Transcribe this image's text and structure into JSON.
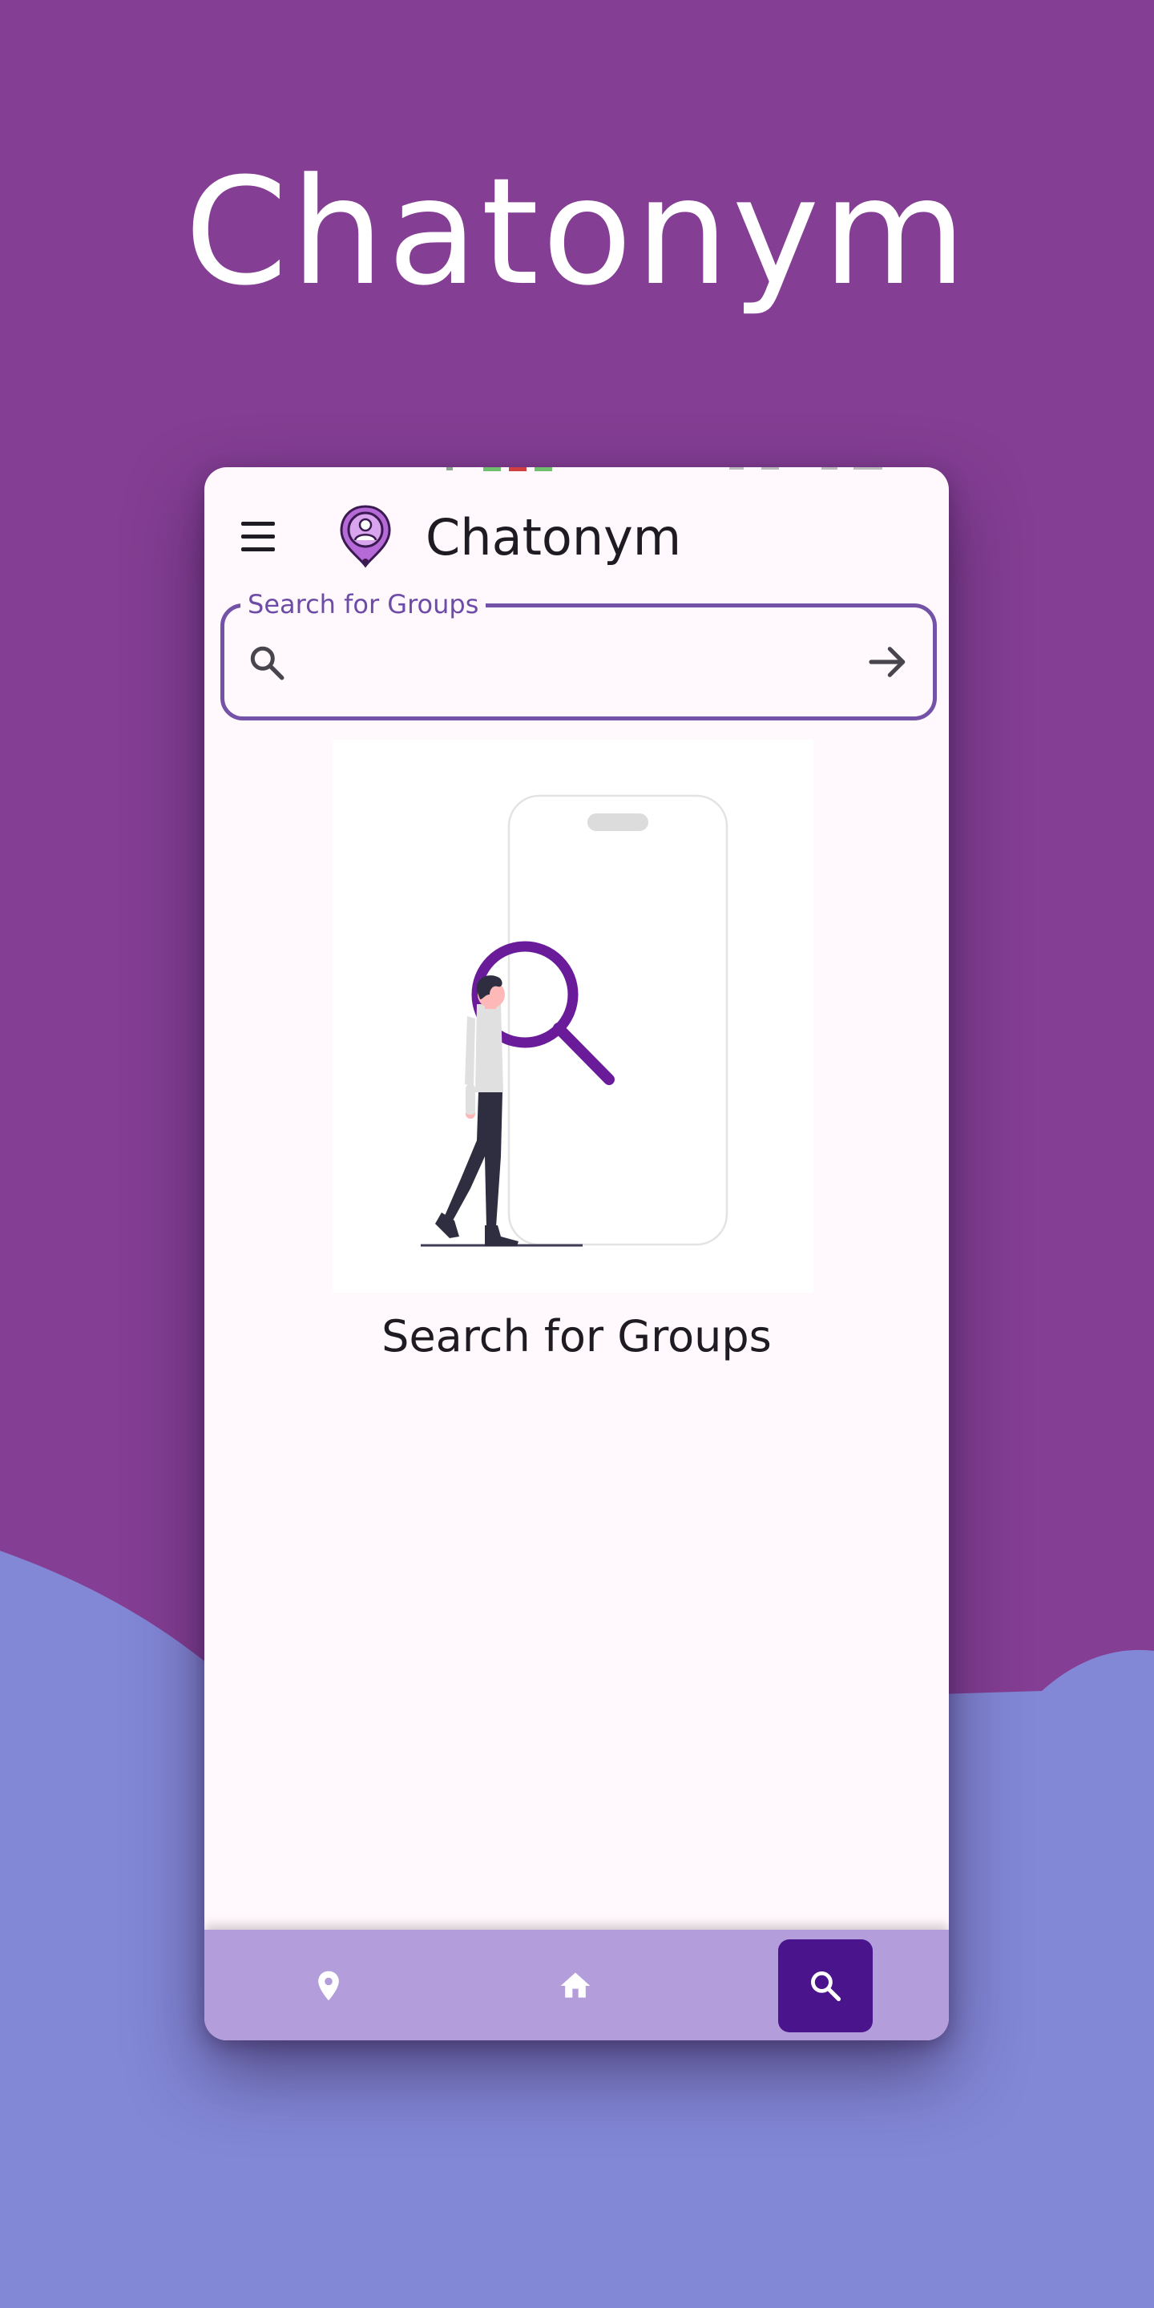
{
  "promo": {
    "headline": "Chatonym"
  },
  "app": {
    "title": "Chatonym"
  },
  "search": {
    "label": "Search for Groups",
    "value": "",
    "placeholder": ""
  },
  "empty_state": {
    "caption": "Search for Groups"
  },
  "bottom_nav": {
    "items": [
      {
        "icon": "location-pin-icon",
        "selected": false
      },
      {
        "icon": "home-icon",
        "selected": false
      },
      {
        "icon": "search-icon",
        "selected": true
      }
    ]
  },
  "colors": {
    "background_purple": "#843e93",
    "wave_blue": "#8287d6",
    "primary_dark": "#4a148c",
    "outline": "#7452a7",
    "nav_bar": "#b39ddb",
    "surface": "#fff8fc"
  }
}
